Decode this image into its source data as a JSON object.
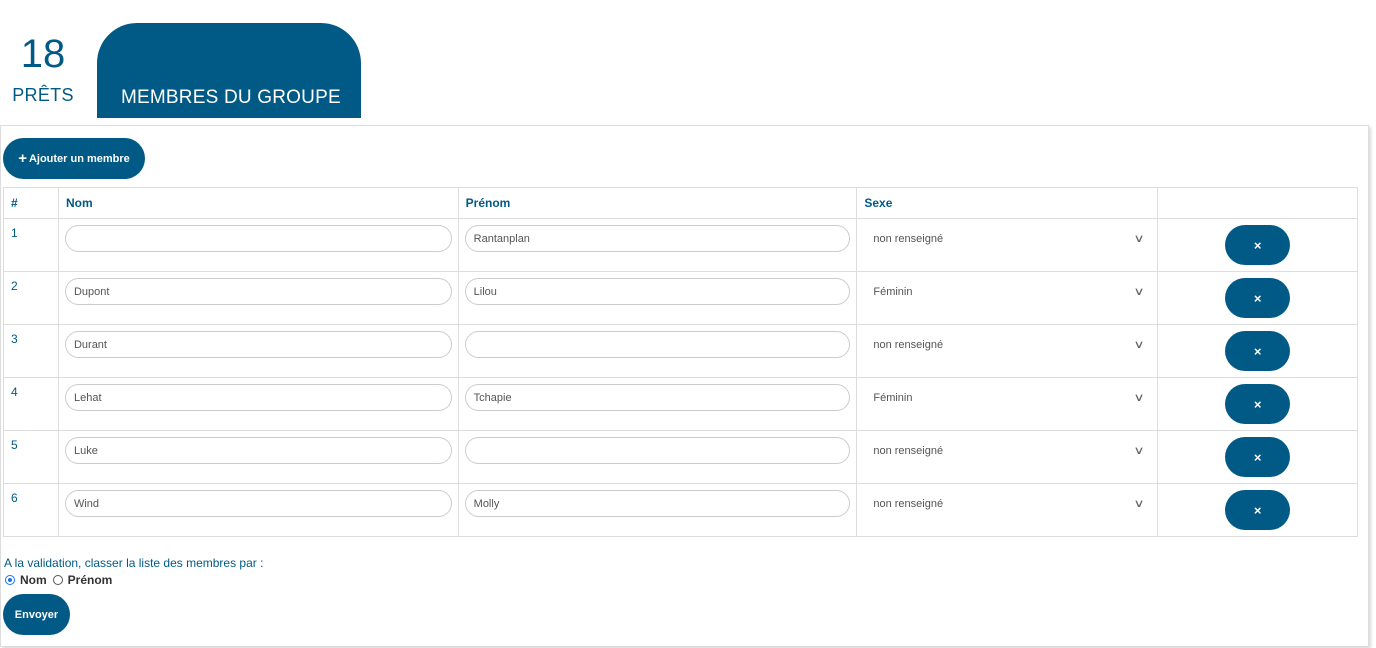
{
  "tabs": {
    "count": "18",
    "count_label": "PRÊTS",
    "active_label": "MEMBRES DU GROUPE"
  },
  "toolbar": {
    "add_member_label": "Ajouter un membre"
  },
  "table": {
    "headers": {
      "num": "#",
      "nom": "Nom",
      "prenom": "Prénom",
      "sexe": "Sexe"
    },
    "rows": [
      {
        "num": "1",
        "nom": "",
        "prenom": "Rantanplan",
        "sexe": "non renseigné"
      },
      {
        "num": "2",
        "nom": "Dupont",
        "prenom": "Lilou",
        "sexe": "Féminin"
      },
      {
        "num": "3",
        "nom": "Durant",
        "prenom": "",
        "sexe": "non renseigné"
      },
      {
        "num": "4",
        "nom": "Lehat",
        "prenom": "Tchapie",
        "sexe": "Féminin"
      },
      {
        "num": "5",
        "nom": "Luke",
        "prenom": "",
        "sexe": "non renseigné"
      },
      {
        "num": "6",
        "nom": "Wind",
        "prenom": "Molly",
        "sexe": "non renseigné"
      }
    ],
    "delete_symbol": "×"
  },
  "sort": {
    "label": "A la validation, classer la liste des membres par :",
    "options": [
      "Nom",
      "Prénom"
    ],
    "selected": "Nom"
  },
  "submit_label": "Envoyer",
  "colors": {
    "primary": "#005a85",
    "radio_selected": "#1a73e8"
  },
  "icons": {
    "add": "plus-icon",
    "delete": "close-icon",
    "select": "chevron-down-icon"
  }
}
